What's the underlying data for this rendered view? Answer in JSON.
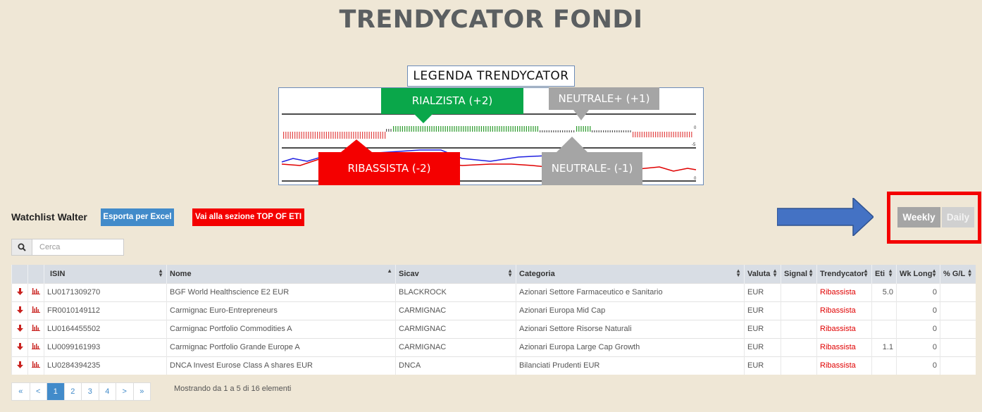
{
  "page": {
    "title": "TRENDYCATOR FONDI"
  },
  "legend": {
    "title": "LEGENDA TRENDYCATOR",
    "rialzista": "RIALZISTA (+2)",
    "neutrale_plus": "NEUTRALE+ (+1)",
    "ribassista": "RIBASSISTA (-2)",
    "neutrale_minus": "NEUTRALE- (-1)",
    "oscillator": "oscillator",
    "scale_zero_top": "0",
    "scale_minus5": "-5",
    "scale_zero_bottom": "0",
    "colors": {
      "green": "#0aa74a",
      "red": "#f40000",
      "gray": "#a5a5a5"
    }
  },
  "toolbar": {
    "watchlist": "Watchlist Walter",
    "export_label": "Esporta per Excel",
    "top_label": "Vai alla sezione TOP OF ETI",
    "weekly_label": "Weekly",
    "daily_label": "Daily",
    "active_period": "Weekly"
  },
  "search": {
    "placeholder": "Cerca",
    "icon": "search-icon"
  },
  "table": {
    "columns": [
      "ISIN",
      "Nome",
      "Sicav",
      "Categoria",
      "Valuta",
      "Signal",
      "Trendycator",
      "Eti",
      "Wk Long",
      "% G/L"
    ],
    "rows": [
      {
        "isin": "LU0171309270",
        "nome": "BGF World Healthscience E2 EUR",
        "sicav": "BLACKROCK",
        "categoria": "Azionari Settore Farmaceutico e Sanitario",
        "valuta": "EUR",
        "signal": "",
        "trend": "Ribassista",
        "eti": "5.0",
        "wk_long": "0",
        "gl": ""
      },
      {
        "isin": "FR0010149112",
        "nome": "Carmignac Euro-Entrepreneurs",
        "sicav": "CARMIGNAC",
        "categoria": "Azionari Europa Mid Cap",
        "valuta": "EUR",
        "signal": "",
        "trend": "Ribassista",
        "eti": "",
        "wk_long": "0",
        "gl": ""
      },
      {
        "isin": "LU0164455502",
        "nome": "Carmignac Portfolio Commodities A",
        "sicav": "CARMIGNAC",
        "categoria": "Azionari Settore Risorse Naturali",
        "valuta": "EUR",
        "signal": "",
        "trend": "Ribassista",
        "eti": "",
        "wk_long": "0",
        "gl": ""
      },
      {
        "isin": "LU0099161993",
        "nome": "Carmignac Portfolio Grande Europe A",
        "sicav": "CARMIGNAC",
        "categoria": "Azionari Europa Large Cap Growth",
        "valuta": "EUR",
        "signal": "",
        "trend": "Ribassista",
        "eti": "1.1",
        "wk_long": "0",
        "gl": ""
      },
      {
        "isin": "LU0284394235",
        "nome": "DNCA Invest Eurose Class A shares EUR",
        "sicav": "DNCA",
        "categoria": "Bilanciati Prudenti EUR",
        "valuta": "EUR",
        "signal": "",
        "trend": "Ribassista",
        "eti": "",
        "wk_long": "0",
        "gl": ""
      }
    ]
  },
  "pagination": {
    "first": "«",
    "prev": "<",
    "pages": [
      "1",
      "2",
      "3",
      "4"
    ],
    "next": ">",
    "last": "»",
    "current": "1",
    "info": "Mostrando da 1 a 5 di 16 elementi"
  }
}
